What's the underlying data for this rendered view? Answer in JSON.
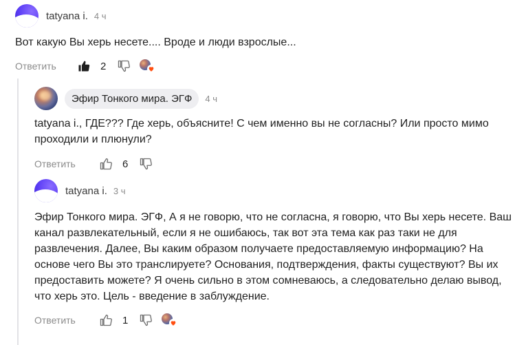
{
  "comments": [
    {
      "author": "tatyana i.",
      "time": "4 ч",
      "text": "Вот какую Вы херь несете.... Вроде и люди взрослые...",
      "reply_label": "Ответить",
      "likes": "2",
      "liked": true,
      "avatar": "purple-swoosh"
    },
    {
      "author": "Эфир Тонкого мира. ЭГФ",
      "time": "4 ч",
      "text": "tatyana i., ГДЕ??? Где херь, объясните! С чем именно вы не согласны? Или просто мимо проходили и плюнули?",
      "reply_label": "Ответить",
      "likes": "6",
      "liked": false,
      "avatar": "cosmic-nebula"
    },
    {
      "author": "tatyana i.",
      "time": "3 ч",
      "text": "Эфир Тонкого мира. ЭГФ, А я не говорю, что не согласна, я говорю, что Вы херь несете. Ваш канал развлекательный, если я не ошибаюсь, так вот эта тема как раз таки не для развлечения. Далее, Вы каким образом получаете предоставляемую информацию? На основе чего Вы это транслируете? Основания, подтверждения, факты существуют? Вы их предоставить можете? Я очень сильно в этом сомневаюсь, а следовательно делаю вывод, что херь это. Цель - введение в заблуждение.",
      "reply_label": "Ответить",
      "likes": "1",
      "liked": false,
      "avatar": "purple-swoosh"
    }
  ],
  "colors": {
    "accent_heart": "#ff4f12",
    "text": "#1f1f1f",
    "muted": "#8b8b8b",
    "chip": "#eeeef1",
    "avatar_purple": "#5b3df5"
  },
  "icons": {
    "like_filled": "thumb-up-filled-icon",
    "like_outline": "thumb-up-outline-icon",
    "dislike": "thumb-down-outline-icon",
    "heart": "heart-icon"
  }
}
